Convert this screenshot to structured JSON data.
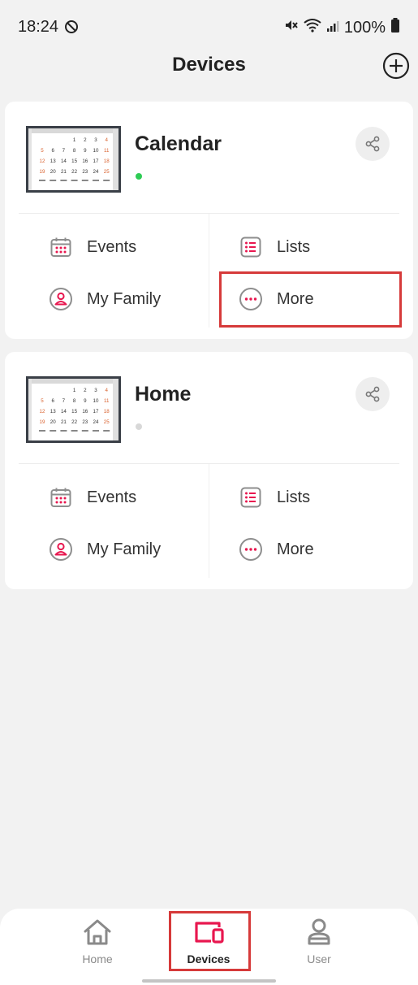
{
  "status_bar": {
    "time": "18:24",
    "battery": "100%"
  },
  "header": {
    "title": "Devices"
  },
  "calendar_thumbnail": {
    "rows": [
      [
        "",
        "",
        "",
        "1",
        "2",
        "3",
        "4"
      ],
      [
        "5",
        "6",
        "7",
        "8",
        "9",
        "10",
        "11"
      ],
      [
        "12",
        "13",
        "14",
        "15",
        "16",
        "17",
        "18"
      ],
      [
        "19",
        "20",
        "21",
        "22",
        "23",
        "24",
        "25"
      ]
    ]
  },
  "devices": [
    {
      "name": "Calendar",
      "status_color": "#2ecc55",
      "actions": {
        "events": "Events",
        "lists": "Lists",
        "family": "My Family",
        "more": "More"
      }
    },
    {
      "name": "Home",
      "status_color": "#d8d8d8",
      "actions": {
        "events": "Events",
        "lists": "Lists",
        "family": "My Family",
        "more": "More"
      }
    }
  ],
  "bottom_nav": {
    "items": [
      {
        "label": "Home",
        "icon": "home-icon"
      },
      {
        "label": "Devices",
        "icon": "devices-icon",
        "active": true
      },
      {
        "label": "User",
        "icon": "user-icon"
      }
    ]
  },
  "colors": {
    "accent": "#e8174f",
    "highlight": "#d63a3a",
    "icon_gray": "#8e8e8e"
  }
}
